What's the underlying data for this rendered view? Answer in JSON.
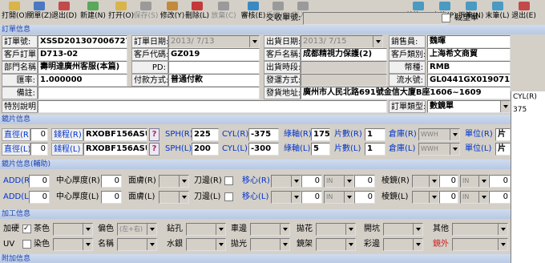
{
  "toolbar": {
    "left": [
      {
        "label": "打開(O)",
        "color": "#d9b44a",
        "enabled": true
      },
      {
        "label": "關單(Z)",
        "color": "#4a78c2",
        "enabled": true
      },
      {
        "label": "退出(D)",
        "color": "#c24a4a",
        "enabled": true
      },
      {
        "label": "新建(N)",
        "color": "#5aa85a",
        "enabled": true
      },
      {
        "label": "打开(O)",
        "color": "#d9b44a",
        "enabled": true
      },
      {
        "label": "保存(S)",
        "color": "#9a9a9a",
        "enabled": false
      },
      {
        "label": "修改(Y)",
        "color": "#c28a3a",
        "enabled": true
      },
      {
        "label": "刪除(L)",
        "color": "#c23a3a",
        "enabled": true
      },
      {
        "label": "放棄(C)",
        "color": "#9a9a9a",
        "enabled": false
      },
      {
        "label": "審核(E)",
        "color": "#3a8ac2",
        "enabled": true
      },
      {
        "label": "反審(E)",
        "color": "#9a9a9a",
        "enabled": false
      },
      {
        "label": "寫入(J)",
        "color": "#9a9a9a",
        "enabled": false
      }
    ],
    "right": [
      {
        "label": "首筆(F)",
        "color": "#4a9ac2",
        "enabled": true
      },
      {
        "label": "上筆(P)",
        "color": "#4a9ac2",
        "enabled": true
      },
      {
        "label": "下筆(N)",
        "color": "#4a9ac2",
        "enabled": true
      },
      {
        "label": "末筆(L)",
        "color": "#4a9ac2",
        "enabled": true
      },
      {
        "label": "退出(E)",
        "color": "#c24a4a",
        "enabled": true
      }
    ]
  },
  "top_strip": {
    "delivery_label": "交收單號:",
    "delivery_value": "",
    "cut_order_label": "裁塑單"
  },
  "sections": {
    "order": "訂單信息",
    "lens": "鏡片信息",
    "lens_aux": "鏡片信息(輔助)",
    "process": "加工信息",
    "extra": "附加信息"
  },
  "order": {
    "order_no_label": "訂單號:",
    "order_no": "XSSD201307006727",
    "order_date_label": "訂單日期:",
    "order_date": "2013/ 7/13",
    "ship_date_label": "出貨日期:",
    "ship_date": "2013/ 7/15",
    "sales_label": "銷售員:",
    "sales": "魏暉",
    "cust_order_label": "客戶訂單:",
    "cust_order": "D713-02",
    "cust_code_label": "客戶代碼:",
    "cust_code": "GZ019",
    "cust_name_label": "客戶名稱:",
    "cust_name": "成都精視力保護(2)",
    "cust_type_label": "客戶類別:",
    "cust_type": "上海希文商貿",
    "store_label": "部門名稱:",
    "store": "壽明達廣州客服(本篇)",
    "pd_label": "PD:",
    "pd": "",
    "ship_time_label": "出貨時段:",
    "ship_time": "",
    "currency_label": "幣種:",
    "currency": "RMB",
    "rate_label": "匯率:",
    "rate": "1.000000",
    "pay_label": "付款方式:",
    "pay": "普通付款",
    "invoice_label": "發運方式:",
    "invoice": "",
    "serial_label": "流水號:",
    "serial": "GL0441GX0190713-02_",
    "note_label": "備註:",
    "note": "",
    "address_label": "發貨地址:",
    "address": "廣州市人民北路691號金信大廈B座1606~1609",
    "special_label": "特別說明:",
    "special": "",
    "order_type_label": "訂單類型:",
    "order_type": "數鏡單"
  },
  "lens_rows": [
    {
      "eye_label": "直徑(R)",
      "eye": "0",
      "code_label": "錢程(R)",
      "code": "RXOBF156ASUVH",
      "q": "?",
      "sph_label": "SPH(R)",
      "sph": "225",
      "cyl_label": "CYL(R)",
      "cyl": "-375",
      "axis_label": "綠軸(R)",
      "axis": "175",
      "qty_label": "片數(R)",
      "qty": "1",
      "wh_label": "倉庫(R)",
      "wh": "WWH",
      "unit_label": "單位(R)",
      "unit": "片"
    },
    {
      "eye_label": "直徑(L)",
      "eye": "0",
      "code_label": "錢程(L)",
      "code": "RXOBF156ASUVH",
      "q": "?",
      "sph_label": "SPH(L)",
      "sph": "200",
      "cyl_label": "CYL(L)",
      "cyl": "-300",
      "axis_label": "綠軸(L)",
      "axis": "5",
      "qty_label": "片數(L)",
      "qty": "1",
      "wh_label": "倉庫(L)",
      "wh": "WWH",
      "unit_label": "單位(L)",
      "unit": "片"
    }
  ],
  "aux_rows": [
    {
      "add_label": "ADD(R)",
      "add": "0",
      "ct_label": "中心厚度(R)",
      "ct": "0",
      "coat_label": "面膚(R)",
      "edge_label": "刀邊(R)",
      "shift_label": "移心(R)",
      "shift_dir": "IN",
      "base_label": "棱鏡(R)",
      "base_dir": "IN",
      "zero": "0"
    },
    {
      "add_label": "ADD(L)",
      "add": "0",
      "ct_label": "中心厚度(L)",
      "ct": "0",
      "coat_label": "面膚(L)",
      "edge_label": "刀邊(L)",
      "shift_label": "移心(L)",
      "shift_dir": "IN",
      "base_label": "棱鏡(L)",
      "base_dir": "IN",
      "zero": "0"
    }
  ],
  "process": {
    "row1": [
      "加硬",
      "茶色",
      "偏色",
      "鉆孔",
      "車邊",
      "拋花",
      "開坑",
      "其他"
    ],
    "row2": [
      "UV",
      "染色",
      "名稱",
      "水銀",
      "拋光",
      "鏡架",
      "彩邊",
      "鏡外"
    ],
    "tint_value": "(左+右)",
    "hard_checked": true
  },
  "right_strip": {
    "header": "CYL(R)",
    "value": "375"
  }
}
